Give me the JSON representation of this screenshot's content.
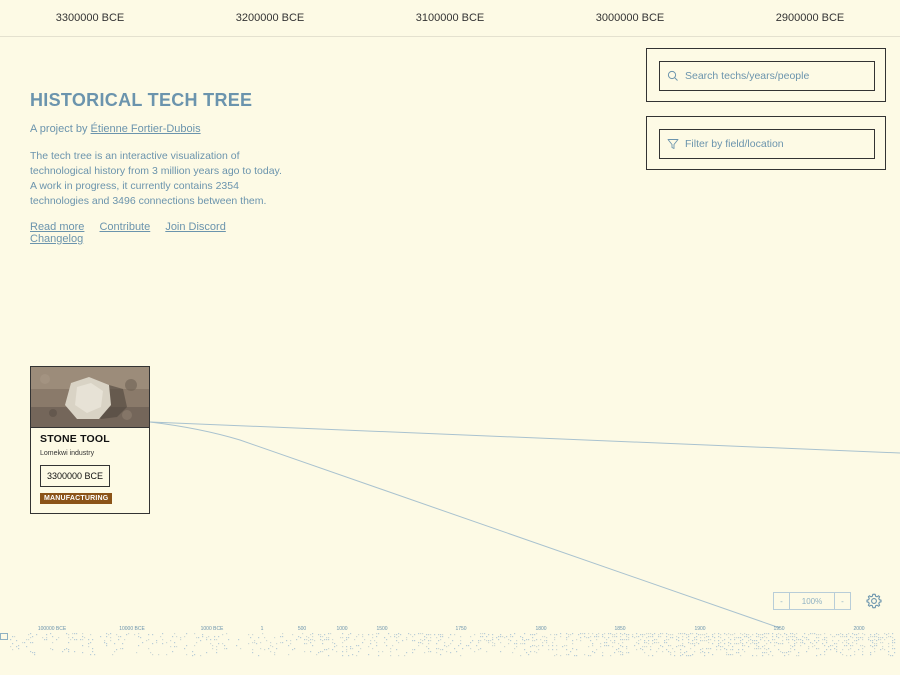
{
  "timeline": {
    "years": [
      "3300000 BCE",
      "3200000 BCE",
      "3100000 BCE",
      "3000000 BCE",
      "2900000 BCE"
    ]
  },
  "intro": {
    "title": "HISTORICAL TECH TREE",
    "byline_prefix": "A project by ",
    "author": "Étienne Fortier-Dubois",
    "description": "The tech tree is an interactive visualization of technological history from 3 million years ago to today. A work in progress, it currently contains 2354 technologies and 3496 connections between them.",
    "links": [
      "Read more",
      "Contribute",
      "Join Discord",
      "Changelog"
    ]
  },
  "search": {
    "placeholder": "Search techs/years/people",
    "icon": "search-icon"
  },
  "filter": {
    "placeholder": "Filter by field/location",
    "icon": "filter-icon"
  },
  "tech_card": {
    "title": "STONE TOOL",
    "subtitle": "Lomekwi industry",
    "date": "3300000 BCE",
    "tag": "MANUFACTURING",
    "tag_color": "#8b5318"
  },
  "zoom": {
    "minus": "-",
    "level": "100%",
    "plus": "-"
  },
  "settings": {
    "icon": "gear-icon"
  },
  "minimap": {
    "labels": [
      "100000 BCE",
      "10000 BCE",
      "1000 BCE",
      "1",
      "500",
      "1000",
      "1500",
      "1750",
      "1800",
      "1850",
      "1900",
      "1950",
      "2000"
    ]
  },
  "colors": {
    "background": "#fdfae5",
    "accent": "#6b94ad",
    "line": "#a9c2cf"
  }
}
